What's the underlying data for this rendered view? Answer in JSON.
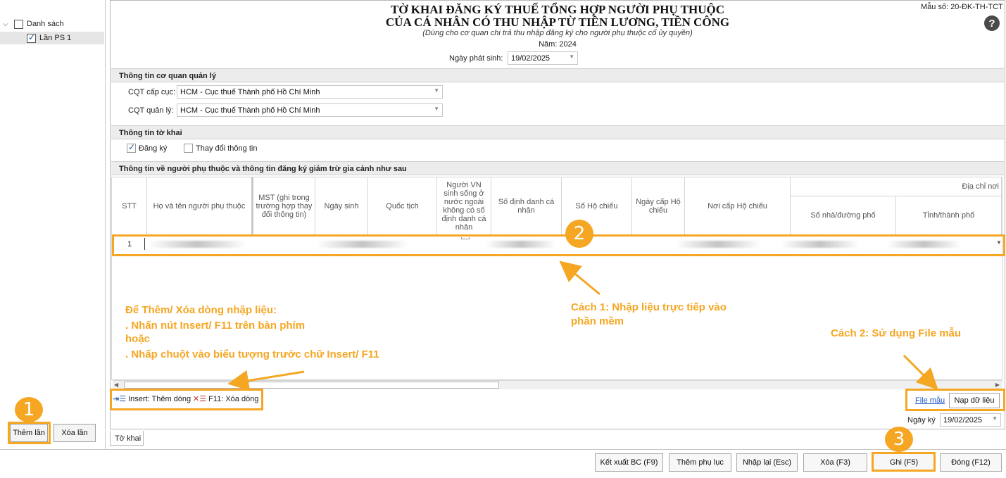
{
  "sidebar": {
    "root_label": "Danh sách",
    "items": [
      {
        "label": "Lần PS 1",
        "checked": true
      }
    ],
    "add_button": "Thêm lần",
    "delete_button": "Xóa lần"
  },
  "header": {
    "form_code": "Mẫu số: 20-ĐK-TH-TCT",
    "title_line1": "TỜ KHAI ĐĂNG KÝ THUẾ TỔNG HỢP NGƯỜI PHỤ THUỘC",
    "title_line2": "CỦA CÁ NHÂN CÓ THU NHẬP TỪ TIỀN LƯƠNG, TIỀN CÔNG",
    "subtitle": "(Dùng cho cơ quan chi trả thu nhập đăng ký cho người phụ thuộc cố ủy quyền)",
    "year": "Năm: 2024",
    "date_label": "Ngày phát sinh:",
    "date_value": "19/02/2025",
    "help_icon": "?"
  },
  "agency": {
    "section_title": "Thông tin cơ quan quản lý",
    "cqt_cap_cuc_label": "CQT cấp cục:",
    "cqt_cap_cuc_value": "HCM - Cục thuế Thành phố Hồ Chí Minh",
    "cqt_quan_ly_label": "CQT quản lý:",
    "cqt_quan_ly_value": "HCM - Cục thuế Thành phố Hồ Chí Minh"
  },
  "declaration": {
    "section_title": "Thông tin tờ khai",
    "register_label": "Đăng ký",
    "register_checked": true,
    "change_label": "Thay đổi thông tin",
    "change_checked": false
  },
  "dependents": {
    "section_title": "Thông tin về người phụ thuộc và thông tin đăng ký giảm trừ gia cảnh như sau",
    "columns": {
      "stt": "STT",
      "name": "Họ và tên người phụ thuộc",
      "mst": "MST (ghi trong trường hợp thay đổi thông tin)",
      "dob": "Ngày sinh",
      "nationality": "Quốc tịch",
      "foreign": "Người VN sinh sống ở nước ngoài không có số định danh cá nhân",
      "id": "Số định danh cá nhân",
      "passport": "Số Hộ chiếu",
      "passport_date": "Ngày cấp Hộ chiếu",
      "passport_place": "Nơi cấp Hộ chiếu",
      "address_group": "Địa chỉ nơi",
      "street": "Số nhà/đường phố",
      "province": "Tỉnh/thành phố"
    },
    "rows": [
      {
        "stt": "1"
      }
    ]
  },
  "grid_footer": {
    "insert_label": "Insert: Thêm dòng",
    "delete_label": "F11: Xóa dòng",
    "template_link": "File mẫu",
    "load_button": "Nạp dữ liệu"
  },
  "sign": {
    "label": "Ngày ký",
    "value": "19/02/2025"
  },
  "tabs": [
    {
      "label": "Tờ khai"
    }
  ],
  "toolbar": {
    "export": "Kết xuất BC (F9)",
    "add_appendix": "Thêm phụ lục",
    "reset": "Nhập lại (Esc)",
    "delete": "Xóa (F3)",
    "save": "Ghi (F5)",
    "close": "Đóng (F12)"
  },
  "annotations": {
    "badge1": "1",
    "badge2": "2",
    "badge3": "3",
    "instructions_title": "Để Thêm/ Xóa dòng nhập liệu:",
    "instructions_line1": ". Nhấn nút Insert/ F11 trên bàn phím",
    "instructions_line2": "hoặc",
    "instructions_line3": ". Nhấp chuột vào biểu tượng trước chữ Insert/ F11",
    "method1": "Cách 1: Nhập liệu trực tiếp vào phần mềm",
    "method2": "Cách 2: Sử dụng File mẫu",
    "accent_color": "#f5a623"
  }
}
